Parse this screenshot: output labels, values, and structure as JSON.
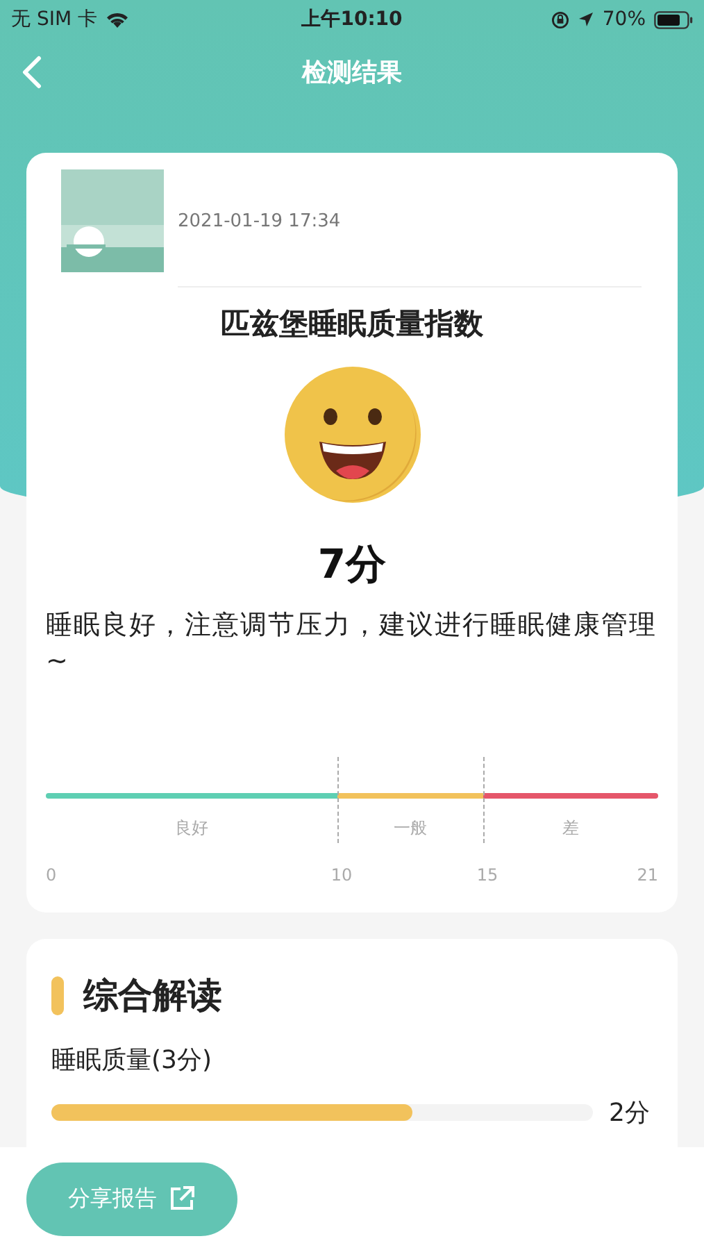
{
  "status_bar": {
    "carrier": "无 SIM 卡",
    "time": "上午10:10",
    "battery": "70%"
  },
  "nav": {
    "title": "检测结果"
  },
  "result": {
    "date": "2021-01-19 17:34",
    "title": "匹兹堡睡眠质量指数",
    "score": "7分",
    "advice": "睡眠良好，注意调节压力，建议进行睡眠健康管理~",
    "scale": {
      "segments": [
        {
          "label": "良好",
          "color": "#5ecfb3"
        },
        {
          "label": "一般",
          "color": "#f2c25c"
        },
        {
          "label": "差",
          "color": "#e5566a"
        }
      ],
      "ticks": [
        "0",
        "10",
        "15",
        "21"
      ]
    }
  },
  "summary": {
    "title": "综合解读",
    "items": [
      {
        "label": "睡眠质量(3分)",
        "level": 0.667,
        "reading": "2分"
      }
    ]
  },
  "share_button": {
    "label": "分享报告"
  }
}
